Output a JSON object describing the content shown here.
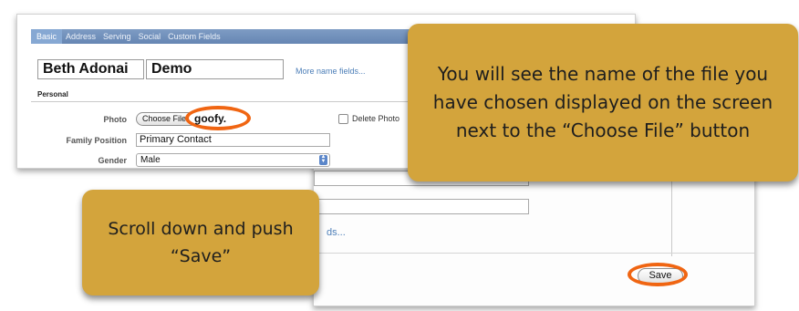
{
  "lower_screenshot": {
    "link_fragment": "ds...",
    "save_button": "Save"
  },
  "upper_screenshot": {
    "tabs": [
      "Basic",
      "Address",
      "Serving",
      "Social",
      "Custom Fields"
    ],
    "first_name": "Beth Adonai",
    "last_name": "Demo",
    "more_name_fields_link": "More name fields...",
    "section_title": "Personal",
    "photo": {
      "label": "Photo",
      "choose_file_button": "Choose File",
      "chosen_file_name": "goofy.",
      "delete_photo_label": "Delete Photo"
    },
    "family_position": {
      "label": "Family Position",
      "value": "Primary Contact"
    },
    "gender": {
      "label": "Gender",
      "value": "Male"
    }
  },
  "callouts": {
    "top": "You will see the name of the file you have chosen displayed on the screen next to the “Choose File” button",
    "bottom": "Scroll down and push “Save”"
  },
  "colors": {
    "callout_background": "#d3a43c",
    "highlight_ring": "#f06512",
    "tab_bar": "#6f8fbb",
    "link": "#4d7fb8"
  },
  "icons": {
    "select_arrows": "updown-arrows-icon"
  }
}
